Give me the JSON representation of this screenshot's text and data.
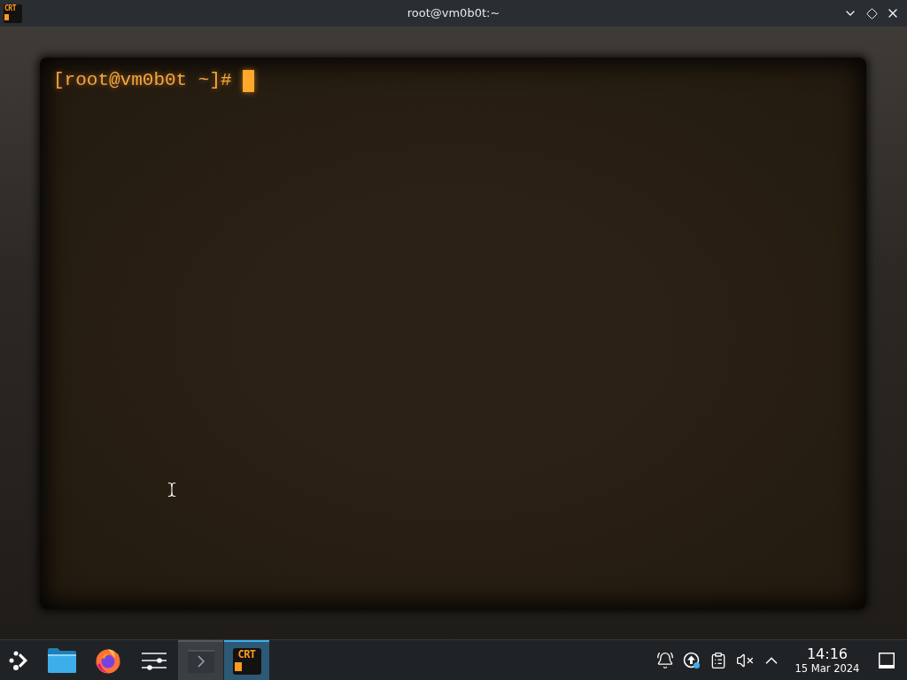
{
  "window": {
    "title": "root@vm0b0t:~",
    "icon_text": "CRT",
    "buttons": [
      {
        "kind": "minimize"
      },
      {
        "kind": "maximize"
      },
      {
        "kind": "close"
      }
    ]
  },
  "terminal": {
    "prompt": "[root@vm0b0t ~]#",
    "cursor": true,
    "mouse_pointer": true
  },
  "taskbar": {
    "launchers": [
      {
        "kind": "launcher"
      },
      {
        "kind": "files"
      },
      {
        "kind": "browser"
      },
      {
        "kind": "settings"
      }
    ],
    "tasks": [
      {
        "kind": "terminal",
        "selected": false
      },
      {
        "kind": "crt",
        "icon_text": "CRT",
        "selected": true
      }
    ],
    "tray": [
      {
        "kind": "notifications"
      },
      {
        "kind": "updates"
      },
      {
        "kind": "clipboard"
      },
      {
        "kind": "volume",
        "muted": true
      },
      {
        "kind": "expand"
      }
    ],
    "clock": {
      "time": "14:16",
      "date": "15 Mar 2024"
    }
  }
}
